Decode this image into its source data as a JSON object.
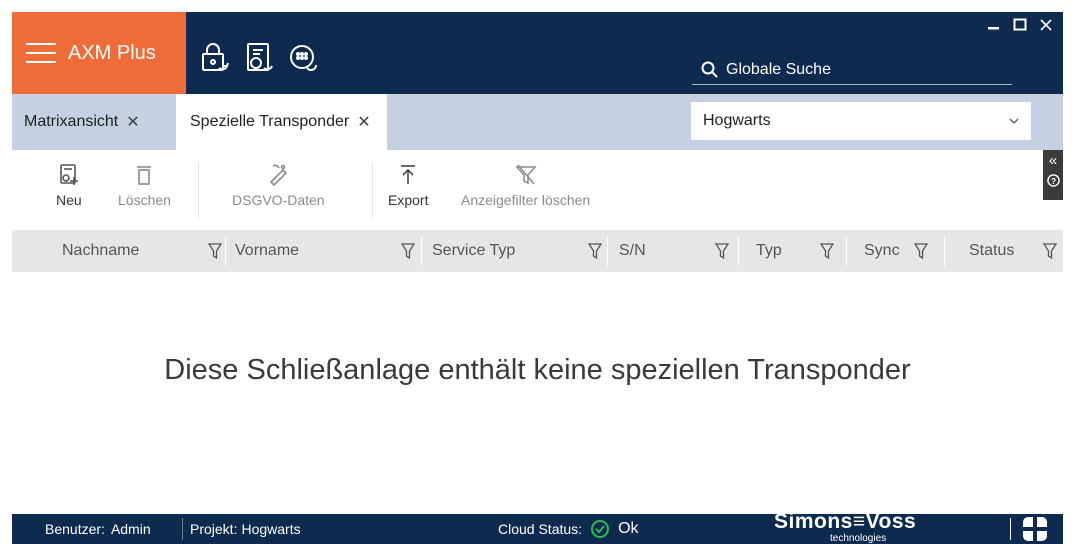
{
  "app": {
    "title": "AXM Plus",
    "window_controls": [
      "minimize",
      "maximize",
      "close"
    ]
  },
  "topbar": {
    "icons": [
      "lock-sync-icon",
      "transponder-sync-icon",
      "keypad-sync-icon"
    ],
    "search_label": "Globale Suche"
  },
  "tabs": [
    {
      "label": "Matrixansicht",
      "active": false
    },
    {
      "label": "Spezielle Transponder",
      "active": true
    }
  ],
  "site_select": {
    "value": "Hogwarts"
  },
  "toolbar": {
    "new_label": "Neu",
    "delete_label": "Löschen",
    "gdpr_label": "DSGVO-Daten",
    "export_label": "Export",
    "clear_filter_label": "Anzeigefilter löschen"
  },
  "columns": [
    "Nachname",
    "Vorname",
    "Service Typ",
    "S/N",
    "Typ",
    "Sync",
    "Status"
  ],
  "empty_message": "Diese Schließanlage enthält keine speziellen Transponder",
  "statusbar": {
    "user_label": "Benutzer:",
    "user_value": "Admin",
    "project_label": "Projekt:",
    "project_value": "Hogwarts",
    "cloud_label": "Cloud Status:",
    "cloud_value": "Ok",
    "logo_text": "Simons≡Voss",
    "logo_sub": "technologies"
  },
  "colors": {
    "navy": "#0e2a4f",
    "brand_orange": "#ee6c37",
    "tabbar": "#c5d0e2",
    "ok_green": "#2fb84f"
  }
}
